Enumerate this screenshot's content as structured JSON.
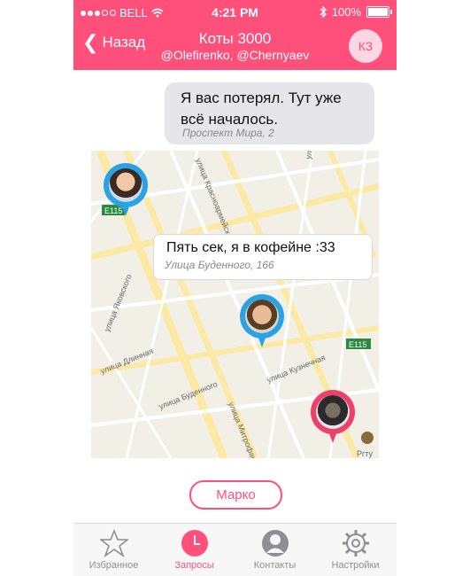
{
  "colors": {
    "accent": "#ff4f7b",
    "bubble": "#e6e6ea",
    "pin_blue": "#2aa3e6",
    "pin_pink": "#ef3f6b",
    "map_bg": "#f2efe6"
  },
  "status_bar": {
    "carrier": "BELL",
    "time": "4:21 PM",
    "battery": "100%"
  },
  "nav": {
    "back_label": "Назад",
    "title": "Коты 3000",
    "subtitle": "@Olefirenko, @Chernyaev",
    "avatar_initials": "КЗ"
  },
  "message": {
    "text": "Я вас потерял. Тут уже всё началось.",
    "location": "Проспект Мира, 2"
  },
  "map": {
    "callout": {
      "text": "Пять сек, я в кофейне :33",
      "location": "Улица Буденного, 166"
    },
    "streets": [
      "улица Красноармейская",
      "улица Рашилевская",
      "улица Яковского",
      "улица Длинная",
      "улица Буденного",
      "улица Кузнечная",
      "улица Митрофанова"
    ],
    "shields": [
      "E115",
      "E115"
    ],
    "poi": "Ргту"
  },
  "marko_button": "Марко",
  "tabs": [
    {
      "label": "Избранное",
      "icon": "star-icon"
    },
    {
      "label": "Запросы",
      "icon": "clock-icon",
      "active": true
    },
    {
      "label": "Контакты",
      "icon": "contact-icon"
    },
    {
      "label": "Настройки",
      "icon": "gear-icon"
    }
  ]
}
